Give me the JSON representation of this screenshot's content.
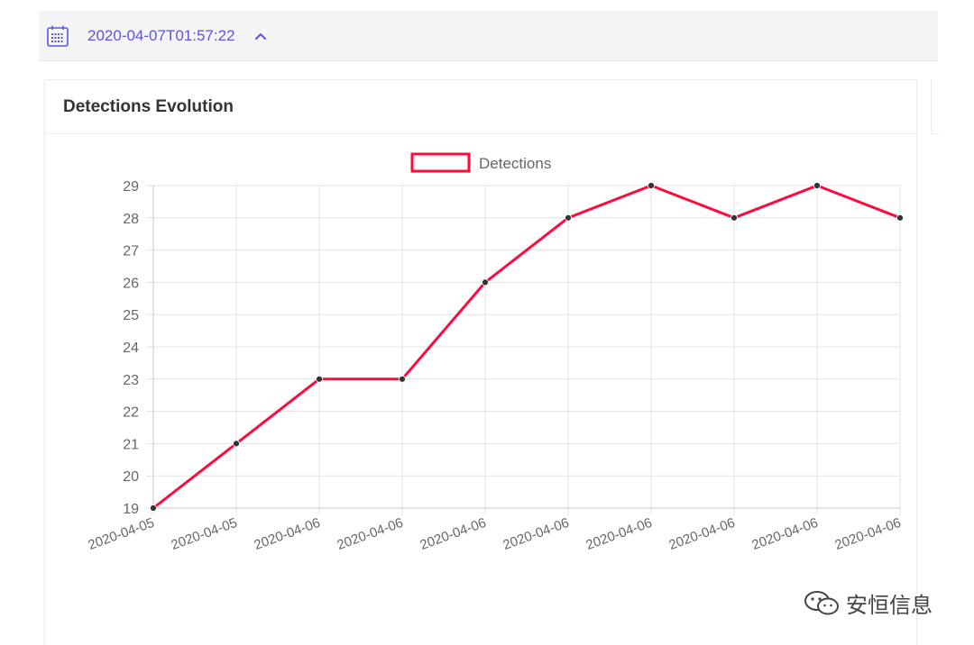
{
  "toolbar": {
    "calendar_icon": "calendar-icon",
    "date_value": "2020-04-07T01:57:22",
    "caret_icon": "chevron-up-icon",
    "accent_color": "#5a55e8"
  },
  "card": {
    "title": "Detections Evolution"
  },
  "watermark": {
    "text": "安恒信息",
    "icon": "wechat-icon"
  },
  "chart_data": {
    "type": "line",
    "categories": [
      "2020-04-05",
      "2020-04-05",
      "2020-04-06",
      "2020-04-06",
      "2020-04-06",
      "2020-04-06",
      "2020-04-06",
      "2020-04-06",
      "2020-04-06",
      "2020-04-06"
    ],
    "series": [
      {
        "name": "Detections",
        "values": [
          19,
          21,
          23,
          23,
          26,
          28,
          29,
          28,
          29,
          28
        ],
        "color": "#ff0a3c"
      }
    ],
    "ylim": [
      19,
      29
    ],
    "yticks": [
      19,
      20,
      21,
      22,
      23,
      24,
      25,
      26,
      27,
      28,
      29
    ],
    "grid": true,
    "legend": "top-center",
    "tick_label_rotation_deg": -20
  }
}
